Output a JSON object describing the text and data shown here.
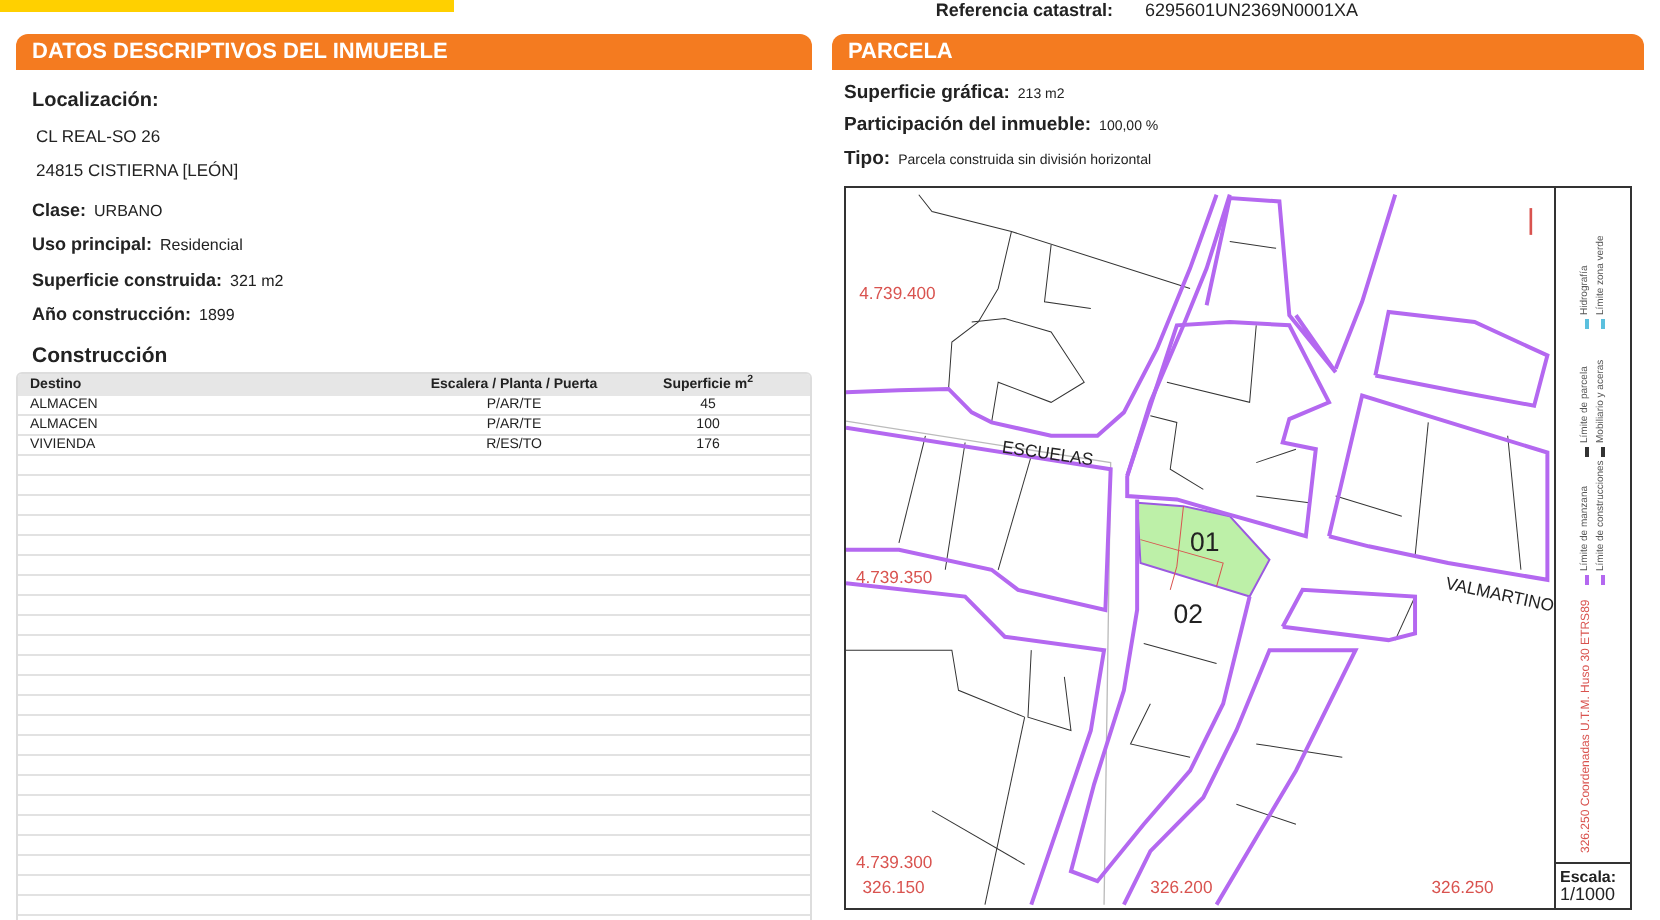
{
  "header": {
    "reference_label": "Referencia catastral:",
    "reference_value": "6295601UN2369N0001XA"
  },
  "descriptive": {
    "title": "DATOS DESCRIPTIVOS DEL **INMUEBLE**",
    "location_label": "Localización:",
    "address_lines": [
      "CL REAL-SO 26",
      "24815 CISTIERNA [LEÓN]"
    ],
    "fields": [
      {
        "label": "Clase:",
        "value": "URBANO"
      },
      {
        "label": "Uso principal:",
        "value": "Residencial"
      },
      {
        "label": "Superficie construida:",
        "value": "321 m2"
      },
      {
        "label": "Año construcción:",
        "value": "1899"
      }
    ],
    "construction": {
      "title": "Construcción",
      "columns": [
        "Destino",
        "Escalera / Planta / Puerta",
        "Superficie m$^{2}$"
      ],
      "rows": [
        [
          "ALMACEN",
          "P/AR/TE",
          "45"
        ],
        [
          "ALMACEN",
          "P/AR/TE",
          "100"
        ],
        [
          "VIVIENDA",
          "R/ES/TO",
          "176"
        ]
      ]
    }
  },
  "parcel": {
    "title": "PARCELA",
    "fields": [
      {
        "label": "Superficie gráfica:",
        "value": "213 m2"
      },
      {
        "label": "Participación del inmueble:",
        "value": "100,00 %"
      },
      {
        "label": "Tipo:",
        "value": "Parcela construida sin división horizontal"
      }
    ],
    "map": {
      "labels": [
        "4.739.400",
        "4.739.350",
        "4.739.300",
        "326.150",
        "326.200",
        "326.250",
        "01",
        "02",
        "ESCUELAS",
        "VALMARTINO"
      ],
      "coordinates_note": "326.250 Coordenadas U.T.M. Huso 30 ETRS89",
      "legend": [
        "Límite de manzana",
        "Límite de construcciones",
        "Límite de parcela",
        "Mobiliario y aceras",
        "Hidrografía",
        "Límite zona verde"
      ],
      "scale_label": "Escala:",
      "scale_value": "1/1000"
    }
  }
}
